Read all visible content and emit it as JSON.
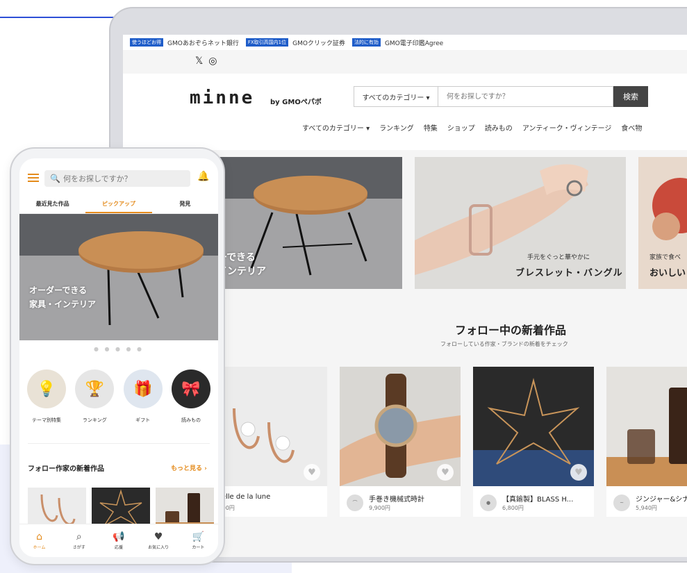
{
  "colors": {
    "accent": "#e48b1c",
    "link_blue": "#1f5dc9",
    "search_button": "#444444"
  },
  "desktop": {
    "topbar": [
      {
        "badge": "使うほどお得",
        "text": "GMOあおぞらネット銀行"
      },
      {
        "badge": "FX取引高国内1位",
        "text": "GMOクリック証券"
      },
      {
        "badge": "法的に有効",
        "text": "GMO電子印鑑Agree"
      }
    ],
    "social": {
      "x": "𝕏",
      "instagram": "◎"
    },
    "logo": "minne",
    "logo_sub": "by GMOペパボ",
    "category_select": "すべてのカテゴリー ▾",
    "search_placeholder": "何をお探しですか？",
    "search_button": "検索",
    "nav": [
      "すべてのカテゴリー ▾",
      "ランキング",
      "特集",
      "ショップ",
      "読みもの",
      "アンティーク・ヴィンテージ",
      "食べ物"
    ],
    "hero": [
      {
        "line1": "ーできる",
        "line2": "インテリア"
      },
      {
        "sub": "手元をぐっと華やかに",
        "main": "ブレスレット・バングル"
      },
      {
        "sub": "家族で食べ",
        "main": "おいしい"
      }
    ],
    "follow": {
      "title": "フォロー中の新着作品",
      "subtitle": "フォローしている作家・ブランドの新着をチェック"
    },
    "cards": [
      {
        "name": "Écelle de la lune",
        "price": "2,700円"
      },
      {
        "name": "手巻き機械式時計",
        "price": "9,900円"
      },
      {
        "name": "【真鍮製】BLASS H...",
        "price": "6,800円"
      },
      {
        "name": "ジンジャー&シナ",
        "price": "5,940円"
      }
    ]
  },
  "mobile": {
    "search_placeholder": "何をお探しですか？",
    "tabs": [
      {
        "label": "最近見た作品"
      },
      {
        "label": "ピックアップ"
      },
      {
        "label": "発見"
      }
    ],
    "hero": {
      "line1": "オーダーできる",
      "line2": "家具・インテリア"
    },
    "dots": "● ● ● ● ●",
    "categories": [
      {
        "label": "テーマ別特集"
      },
      {
        "label": "ランキング"
      },
      {
        "label": "ギフト"
      },
      {
        "label": "読みもの"
      }
    ],
    "section_title": "フォロー作家の新着作品",
    "more": "もっと見る ›",
    "bottom_nav": [
      {
        "label": "ホーム",
        "icon": "home-icon"
      },
      {
        "label": "さがす",
        "icon": "search-icon"
      },
      {
        "label": "応援",
        "icon": "megaphone-icon"
      },
      {
        "label": "お気に入り",
        "icon": "heart-icon"
      },
      {
        "label": "カート",
        "icon": "cart-icon"
      }
    ]
  }
}
